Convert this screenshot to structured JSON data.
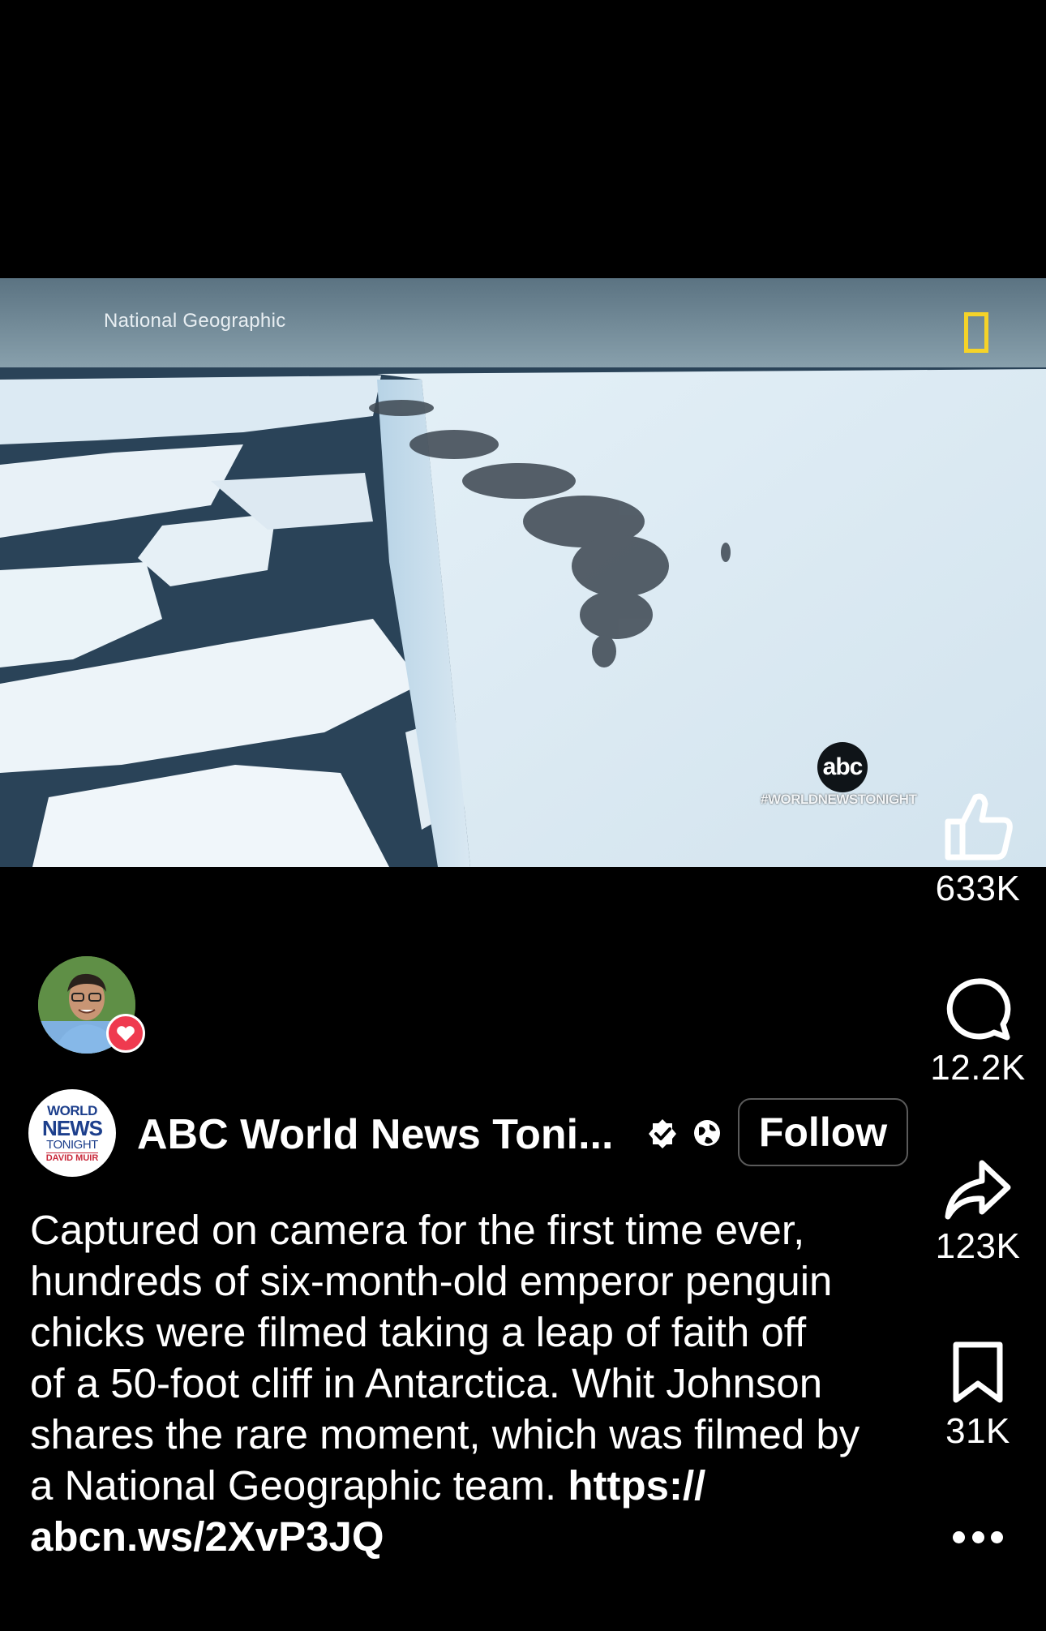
{
  "video": {
    "watermark_label": "National Geographic",
    "bug_logo": "abc",
    "hashtag": "#WORLDNEWSTONIGHT"
  },
  "actions": {
    "likes": "633K",
    "comments": "12.2K",
    "shares": "123K",
    "saves": "31K"
  },
  "account": {
    "name": "ABC World News Toni...",
    "follow_label": "Follow",
    "logo_lines": [
      "WORLD",
      "NEWS",
      "TONIGHT",
      "DAVID MUIR"
    ]
  },
  "caption": {
    "line1": "Captured on camera for the first time ever,",
    "line2": "hundreds of six-month-old emperor penguin",
    "line3": "chicks were filmed taking a leap of faith off",
    "line4": "of a 50-foot cliff in Antarctica. Whit Johnson",
    "line5": "shares the rare moment, which was filmed by",
    "line6_text": "a National Geographic team. ",
    "line6_link": "https://",
    "line7_link": "abcn.ws/2XvP3JQ"
  },
  "colors": {
    "background": "#000000",
    "like_badge": "#ef3a4f",
    "natgeo_yellow": "#f5d328"
  },
  "icons": [
    "thumbs-up-icon",
    "comment-icon",
    "share-icon",
    "bookmark-icon",
    "more-icon",
    "verified-icon",
    "globe-icon",
    "heart-icon"
  ]
}
